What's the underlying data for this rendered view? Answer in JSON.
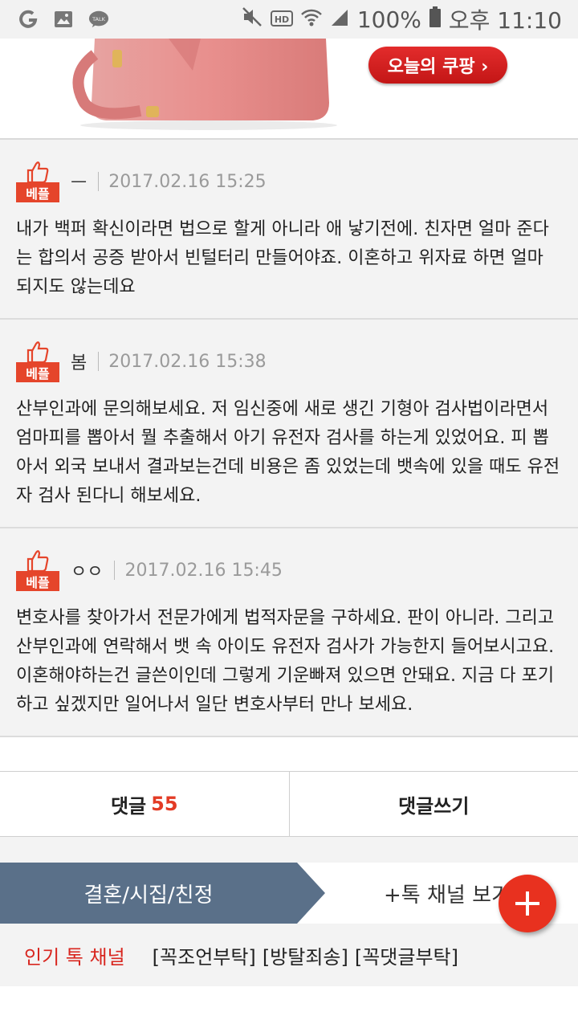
{
  "status_bar": {
    "battery_percent": "100%",
    "time": "오후 11:10",
    "left_icons": [
      "g-app-icon",
      "image-icon",
      "talk-icon"
    ],
    "right_icons": [
      "mute-icon",
      "hd-icon",
      "wifi-icon",
      "signal-icon",
      "battery-icon"
    ],
    "hd_label": "HD",
    "talk_label": "TALK"
  },
  "ad": {
    "button_label": "오늘의 쿠팡 ›",
    "colors": {
      "button": "#d92020",
      "bag": "#e89a98"
    }
  },
  "badge_label": "베플",
  "comments": [
    {
      "nickname": "ㅡ",
      "date": "2017.02.16 15:25",
      "body": "내가 백퍼 확신이라면 법으로 할게 아니라 애 낳기전에. 친자면 얼마 준다는 합의서 공증 받아서 빈털터리 만들어야죠. 이혼하고 위자료 하면 얼마 되지도 않는데요"
    },
    {
      "nickname": "봄",
      "date": "2017.02.16 15:38",
      "body": "산부인과에 문의해보세요. 저 임신중에 새로 생긴 기형아 검사법이라면서 엄마피를 뽑아서 뭘 추출해서 아기 유전자 검사를 하는게 있었어요. 피 뽑아서 외국 보내서 결과보는건데 비용은 좀 있었는데 뱃속에 있을 때도 유전자 검사 된다니 해보세요."
    },
    {
      "nickname": "ㅇㅇ",
      "date": "2017.02.16 15:45",
      "body": "변호사를 찾아가서 전문가에게 법적자문을 구하세요. 판이 아니라. 그리고 산부인과에 연락해서 뱃 속 아이도 유전자 검사가 가능한지 들어보시고요. 이혼해야하는건 글쓴이인데 그렇게 기운빠져 있으면 안돼요. 지금 다 포기하고 싶겠지만 일어나서 일단 변호사부터 만나 보세요."
    }
  ],
  "actions": {
    "comments_label": "댓글",
    "comments_count": "55",
    "write_label": "댓글쓰기"
  },
  "channel": {
    "title": "결혼/시집/친정",
    "more_label": "+톡 채널 보기",
    "color": "#5a7089"
  },
  "popular": {
    "label": "인기 톡 채널",
    "items": [
      "[꼭조언부탁]",
      "[방탈죄송]",
      "[꼭댓글부탁]"
    ]
  },
  "fab": {
    "icon": "plus-icon",
    "color": "#e8311f"
  }
}
